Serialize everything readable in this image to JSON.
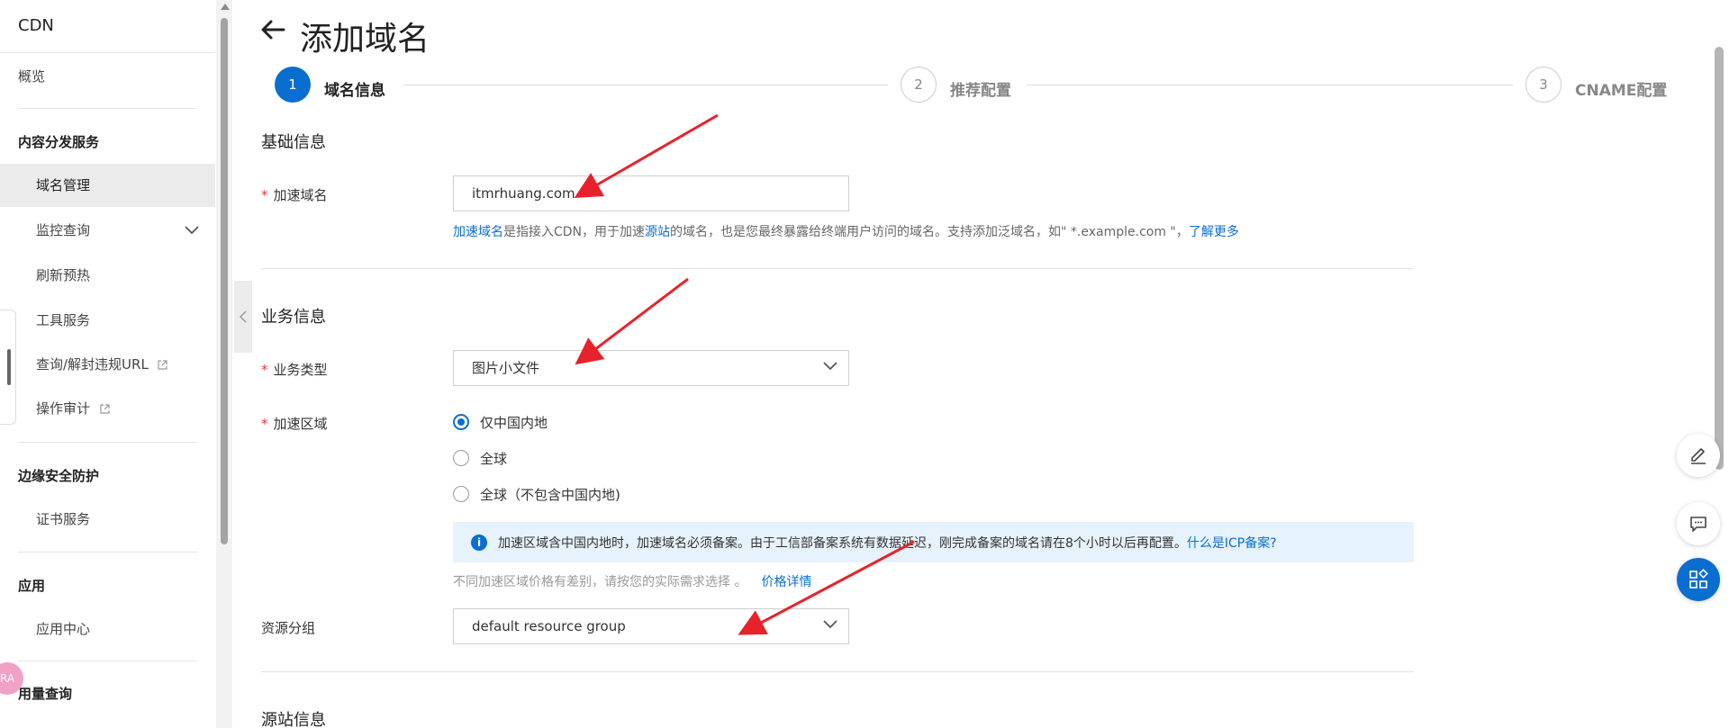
{
  "sidebar": {
    "title": "CDN",
    "overview": "概览",
    "sections": {
      "content_delivery": "内容分发服务",
      "edge_security": "边缘安全防护",
      "apps": "应用",
      "usage": "用量查询"
    },
    "items": {
      "domain_manage": "域名管理",
      "monitor": "监控查询",
      "refresh": "刷新预热",
      "tools": "工具服务",
      "url_block": "查询/解封违规URL",
      "audit": "操作审计",
      "cert": "证书服务",
      "app_center": "应用中心"
    },
    "avatar_text": "RA"
  },
  "header": {
    "title": "添加域名"
  },
  "steps": [
    {
      "number": "1",
      "label": "域名信息"
    },
    {
      "number": "2",
      "label": "推荐配置"
    },
    {
      "number": "3",
      "label": "CNAME配置"
    }
  ],
  "basic_info": {
    "title": "基础信息",
    "domain_label": "加速域名",
    "domain_value": "itmrhuang.com",
    "hint_link1": "加速域名",
    "hint_text1": "是指接入CDN，用于加速",
    "hint_link2": "源站",
    "hint_text2": "的域名，也是您最终暴露给终端用户访问的域名。支持添加泛域名，如\" *.example.com \"，",
    "hint_link3": "了解更多"
  },
  "business_info": {
    "title": "业务信息",
    "type_label": "业务类型",
    "type_value": "图片小文件",
    "region_label": "加速区域",
    "region_options": [
      "仅中国内地",
      "全球",
      "全球（不包含中国内地)"
    ],
    "region_selected": 0,
    "info_text": "加速区域含中国内地时，加速域名必须备案。由于工信部备案系统有数据延迟，刚完成备案的域名请在8个小时以后再配置。",
    "info_link": "什么是ICP备案?",
    "price_hint": "不同加速区域价格有差别，请按您的实际需求选择 。",
    "price_link": "价格详情",
    "group_label": "资源分组",
    "group_value": "default resource group"
  },
  "origin_info": {
    "title": "源站信息"
  },
  "colors": {
    "accent": "#0a6ed1",
    "required": "#e0393e",
    "arrow": "#e8222c"
  }
}
